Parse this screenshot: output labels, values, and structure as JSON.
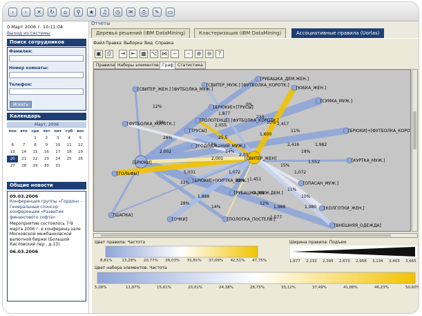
{
  "browser": {
    "toolbar_icons": [
      "back-icon",
      "forward-icon",
      "stop-icon",
      "refresh-icon",
      "home-icon",
      "search-icon",
      "favorites-icon",
      "media-icon",
      "history-icon",
      "mail-icon",
      "print-icon",
      "edit-icon",
      "folder-icon"
    ]
  },
  "sidebar": {
    "date": "0 Март 2006 г. 10:11:04",
    "logout": "Выход из системы",
    "search": {
      "title": "Поиск сотрудников",
      "surname_label": "Фамилия:",
      "room_label": "Номер комнаты:",
      "phone_label": "Телефон:",
      "button": "Искать"
    },
    "calendar": {
      "title": "Календарь",
      "nav": "Март, 2006",
      "weekdays": [
        "пон",
        "вто",
        "сре",
        "чет",
        "пят",
        "суб",
        "вос"
      ],
      "weeks": [
        [
          "",
          "",
          "1",
          "2",
          "3",
          "4",
          "5"
        ],
        [
          "6",
          "7",
          "8",
          "9",
          "10",
          "11",
          "12"
        ],
        [
          "13",
          "14",
          "15",
          "16",
          "17",
          "18",
          "19"
        ],
        [
          "20",
          "21",
          "22",
          "23",
          "24",
          "25",
          "26"
        ],
        [
          "27",
          "28",
          "29",
          "30",
          "31",
          "",
          ""
        ]
      ]
    },
    "news": {
      "title": "Общие новости",
      "item1_date": "09.03.2006",
      "item1_text": "Конференция группы «Гордон» - Генеральный спонсор конференции «Развития финансового софта»",
      "item2_text": "Мероприятие состоялось 7-9 марта 2006 г. в конференц-зале Московской межбанковской валютной биржи (Большой Кисловский пер., д.13).",
      "item2_date": "06.03.2006"
    }
  },
  "main": {
    "section_label": "Отчеты",
    "tabs": [
      {
        "label": "Деревья решений (IBM DataMining)",
        "active": false
      },
      {
        "label": "Кластеризация (IBM DataMining)",
        "active": false
      },
      {
        "label": "Ассоциативные правила (Uorlas)",
        "active": true
      }
    ],
    "menu": [
      "Файл",
      "Правка",
      "Выборка",
      "Вид",
      "Справка"
    ],
    "toolbar_icons": [
      "save-icon",
      "print-icon",
      "redo-icon",
      "undo-icon",
      "table-icon",
      "tree-icon",
      "network-icon",
      "minus-icon",
      "dash-icon",
      "zoom-in-icon",
      "zoom-out-icon",
      "help-icon"
    ],
    "subtabs": [
      {
        "label": "Правила",
        "active": false
      },
      {
        "label": "Наборы элементов",
        "active": false
      },
      {
        "label": "Граф",
        "active": true
      },
      {
        "label": "Статистика",
        "active": false
      }
    ]
  },
  "graph": {
    "hub_left_label": "[БРЮКИ]",
    "hub_center_label": "[СВИТЕР_ЖЕН]",
    "nodes": [
      "[СВИТЕР_ЖЕН.] [ФУТБОЛКА_МУЖ.]",
      "[СВИТЕР_МУЖ.] [ФУТБОЛКА_КОРОТК.]",
      "[РУБАШКА_ДЕМ.ЖЕН.]",
      "[ЮБКА_ЖЕН.]",
      "[СУМКА_МУЖ.]",
      "[ФУТБОЛКА_КОРОТК.]",
      "[БРЮКИ]+[ТРУСЫ]",
      "[ТРУСЫ]",
      "[БРЮКИ]+[ФУТБОЛКА_КОРОТК.]",
      "[ПОЛОТЕНЦЕ] [ФУТБОЛКА_КОРОТК.]",
      "[КУРТКА_МУЖ.]",
      "[КОЛГОТКИ_ЖЕН.]",
      "[ГОДОДАШНИЙ_МУЖ.]",
      "[БРЮКИ]+[КУРТКА_МУЖ.]",
      "[РУБАШКА_МУЖ.ДЕМ.]",
      "[ГОЛЬФЫ]",
      "[ПОЛОТКА_ПОСТЕЛЬ.]",
      "[ОПАСАН_МУЖ.]",
      "[ВНЕШНЯЯ_ОДЕЖДА]",
      "[ОЧКИ]",
      "[ШАПКА]"
    ],
    "edge_labels": [
      "12%",
      "1,877",
      "19%",
      "2,055",
      "25,5",
      "0%",
      "233",
      "10%",
      "2,417",
      "11%",
      "2,416",
      "17%",
      "2,001",
      "1,072",
      "22%",
      "1,451",
      "5,031",
      "33%",
      "0,208",
      "12%",
      "1,988",
      "15%",
      "1,072",
      "18%",
      "1,552",
      "28%",
      "1,600",
      "2,037",
      "34%",
      "2,002",
      "28%",
      "1,577",
      "10%",
      "1,980",
      "11%",
      "1,888",
      "14%",
      "1,982"
    ]
  },
  "rule_legend": {
    "title": "Цвет правила: Частота",
    "ticks": [
      "8,81%",
      "13,28%",
      "20,77%",
      "26,03%",
      "31,81%",
      "37,08%",
      "42,51%",
      "47,75%"
    ],
    "colors": [
      "#8fa6d8",
      "#ffffff",
      "#f2c300"
    ]
  },
  "width_legend": {
    "title": "Ширина правила: Подъем",
    "ticks": [
      "1,677",
      "2,132",
      "2,395",
      "2,673",
      "2,958",
      "3,134",
      "3,403",
      "3,665"
    ]
  },
  "itemset_legend": {
    "title": "Цвет набора элементов: Частота",
    "ticks": [
      "5,08%",
      "11,87%",
      "15,61%",
      "20,01%",
      "24,38%",
      "28,75%",
      "33,12%",
      "37,49%",
      "41,86%",
      "46,23%",
      "50,60%"
    ],
    "colors": [
      "#8fa6d8",
      "#ffffff",
      "#f2c300"
    ]
  }
}
